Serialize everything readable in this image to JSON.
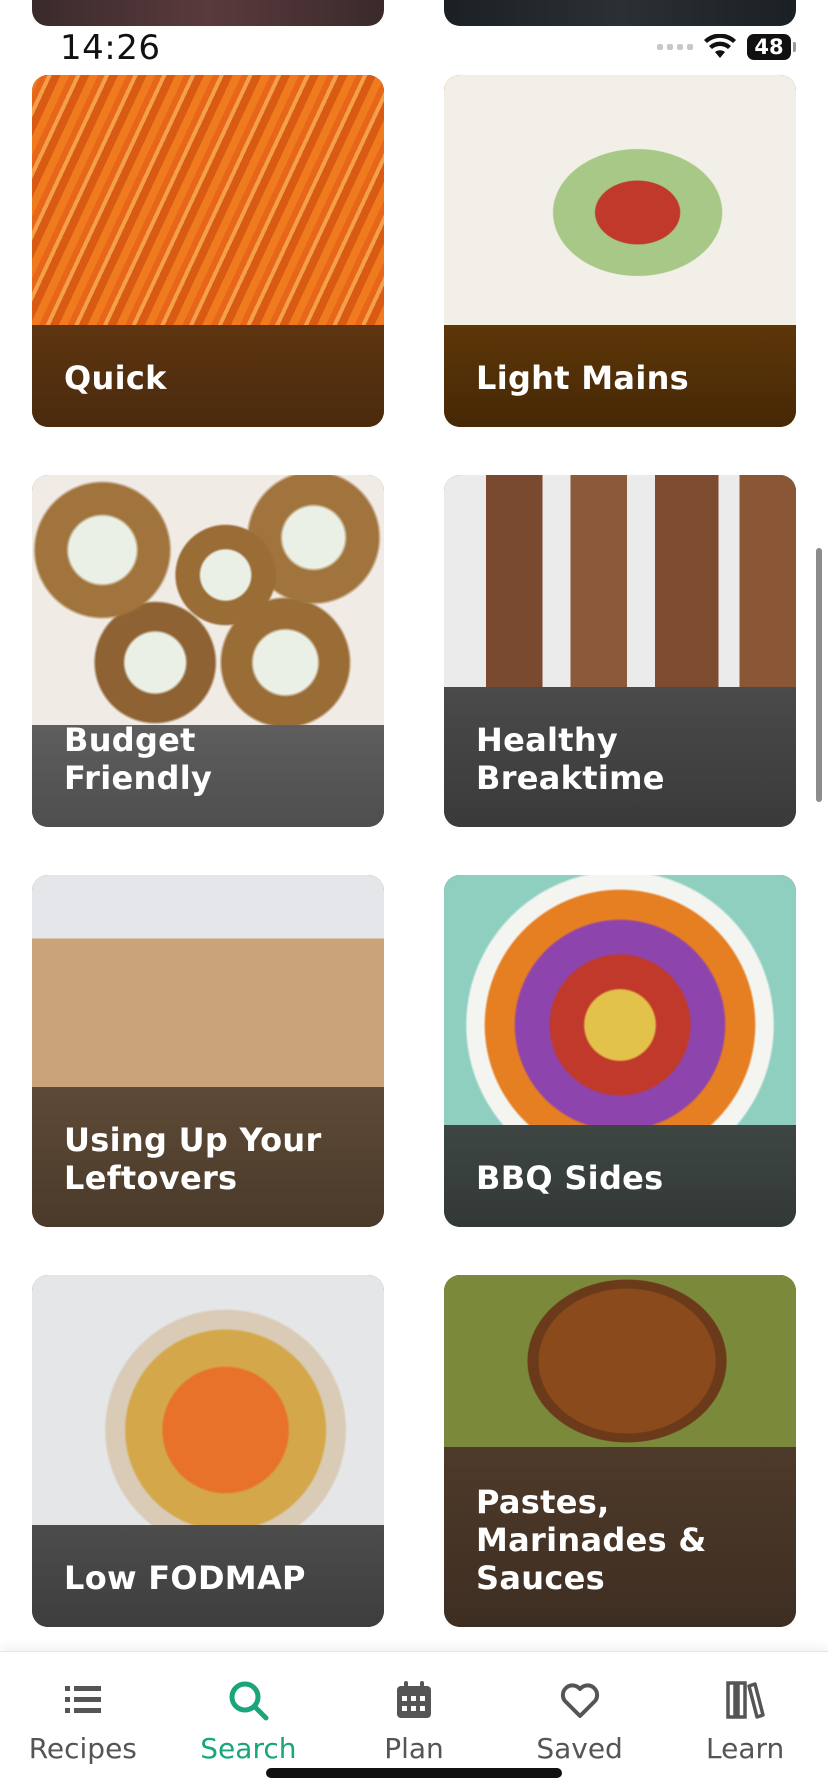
{
  "status": {
    "time": "14:26",
    "battery": "48"
  },
  "categories": [
    {
      "label": "Quick"
    },
    {
      "label": "Light Mains"
    },
    {
      "label": "Budget Friendly"
    },
    {
      "label": "Healthy Breaktime"
    },
    {
      "label": "Using Up Your Leftovers"
    },
    {
      "label": "BBQ Sides"
    },
    {
      "label": "Low FODMAP"
    },
    {
      "label": "Pastes, Marinades & Sauces"
    }
  ],
  "tabs": [
    {
      "label": "Recipes",
      "icon": "list-icon"
    },
    {
      "label": "Search",
      "icon": "search-icon",
      "active": true
    },
    {
      "label": "Plan",
      "icon": "calendar-icon"
    },
    {
      "label": "Saved",
      "icon": "heart-icon"
    },
    {
      "label": "Learn",
      "icon": "books-icon"
    }
  ],
  "colors": {
    "accent": "#1aa67a",
    "tab_inactive": "#555555"
  }
}
